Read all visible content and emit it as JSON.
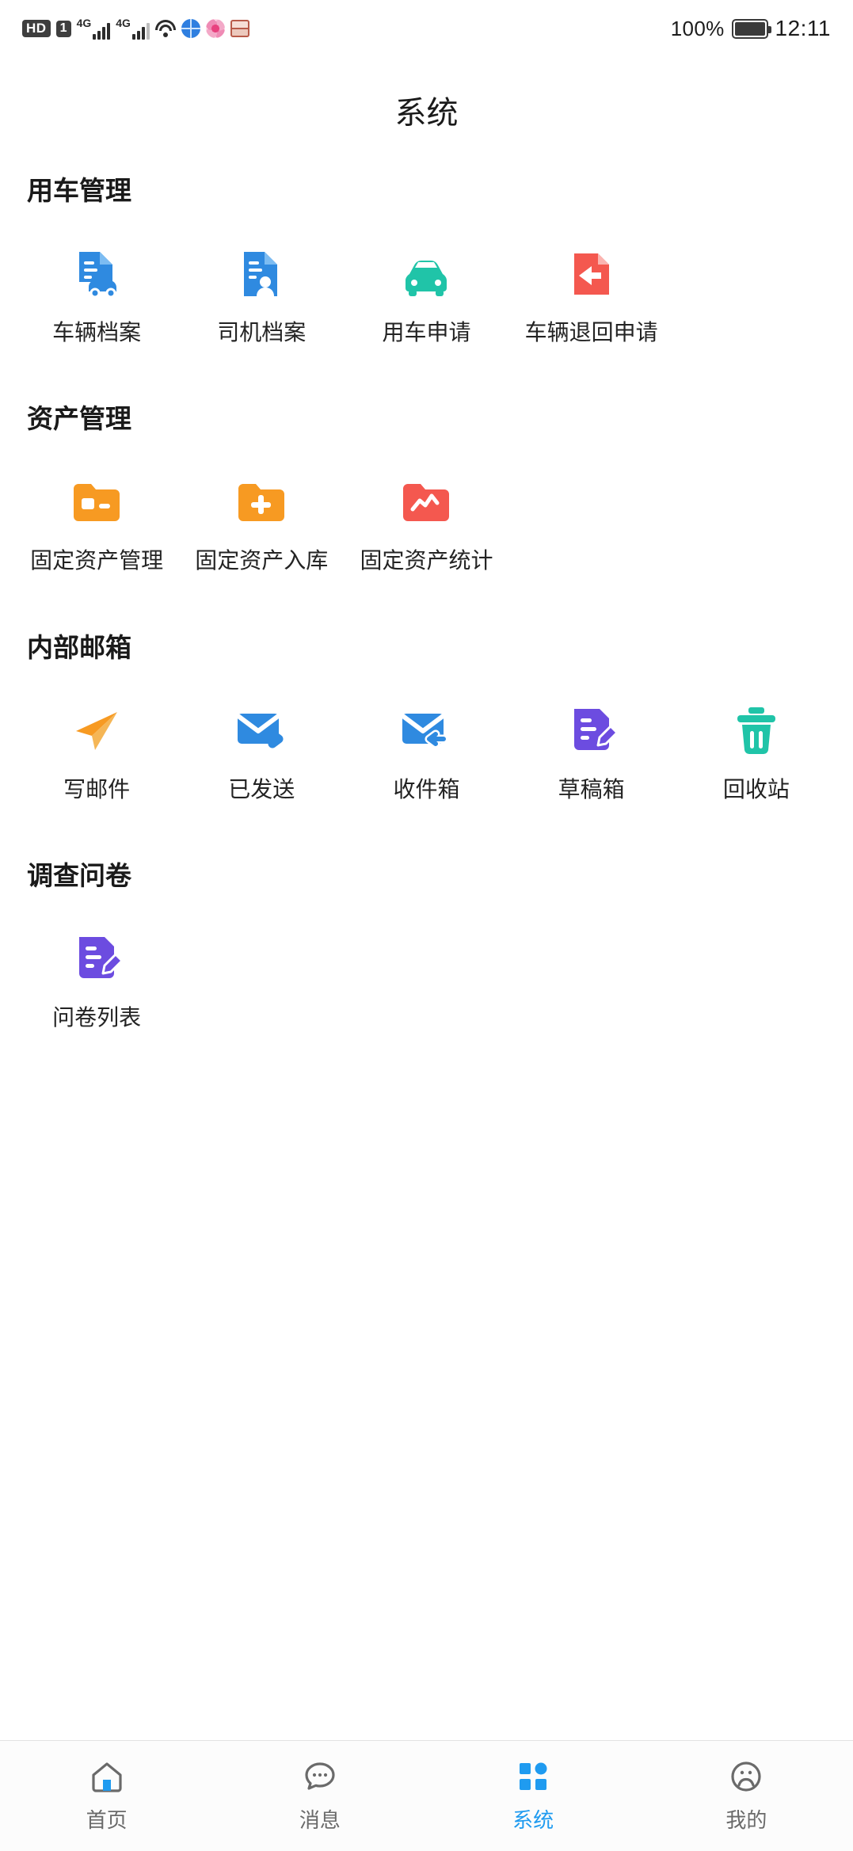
{
  "status_bar": {
    "hd_label": "HD",
    "sim_label": "1",
    "net1_label": "4G",
    "net2_label": "4G",
    "battery_percent": "100%",
    "time": "12:11",
    "icons": [
      "hd-badge",
      "sim-badge",
      "signal-bars",
      "signal-bars",
      "wifi-icon",
      "globe-icon",
      "flower-icon",
      "box-icon",
      "battery-icon"
    ]
  },
  "header": {
    "title": "系统"
  },
  "sections": [
    {
      "title": "用车管理",
      "items": [
        {
          "label": "车辆档案",
          "icon": "vehicle-file-icon",
          "color": "#2f8ae0"
        },
        {
          "label": "司机档案",
          "icon": "driver-file-icon",
          "color": "#2f8ae0"
        },
        {
          "label": "用车申请",
          "icon": "car-apply-icon",
          "color": "#20c4a8"
        },
        {
          "label": "车辆退回申请",
          "icon": "vehicle-return-icon",
          "color": "#f4584f"
        }
      ]
    },
    {
      "title": "资产管理",
      "items": [
        {
          "label": "固定资产管理",
          "icon": "asset-manage-icon",
          "color": "#f79a22"
        },
        {
          "label": "固定资产入库",
          "icon": "asset-inbound-icon",
          "color": "#f79a22"
        },
        {
          "label": "固定资产统计",
          "icon": "asset-stats-icon",
          "color": "#f4584f"
        }
      ]
    },
    {
      "title": "内部邮箱",
      "items": [
        {
          "label": "写邮件",
          "icon": "compose-mail-icon",
          "color": "#f79a22"
        },
        {
          "label": "已发送",
          "icon": "sent-mail-icon",
          "color": "#2f8ae0"
        },
        {
          "label": "收件箱",
          "icon": "inbox-mail-icon",
          "color": "#2f8ae0"
        },
        {
          "label": "草稿箱",
          "icon": "draft-mail-icon",
          "color": "#6c4ce0"
        },
        {
          "label": "回收站",
          "icon": "trash-icon",
          "color": "#20c4a8"
        }
      ]
    },
    {
      "title": "调查问卷",
      "items": [
        {
          "label": "问卷列表",
          "icon": "survey-list-icon",
          "color": "#6c4ce0"
        }
      ]
    }
  ],
  "tabbar": {
    "active_index": 2,
    "accent_color": "#1f9bf0",
    "items": [
      {
        "label": "首页",
        "icon": "home-icon"
      },
      {
        "label": "消息",
        "icon": "message-icon"
      },
      {
        "label": "系统",
        "icon": "grid-icon"
      },
      {
        "label": "我的",
        "icon": "profile-icon"
      }
    ]
  }
}
